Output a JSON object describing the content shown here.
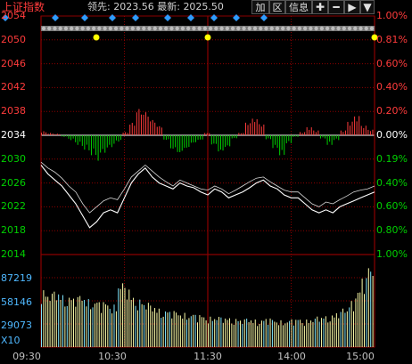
{
  "header": {
    "title": "上证指数",
    "lead_label": "领先:",
    "lead_value": "2023.56",
    "latest_label": "最新:",
    "latest_value": "2025.50"
  },
  "toolbar": {
    "add_label": "加",
    "zone_label": "区",
    "info_label": "信息",
    "plus_icon": "plus-icon",
    "minus_icon": "minus-icon",
    "next_icon": "arrow-right-icon",
    "menu_icon": "dropdown-icon"
  },
  "colors": {
    "up": "#ff3b3b",
    "down": "#00d000",
    "grid": "#8b0000",
    "price_line": "#ffffff",
    "lead_line": "#ffffff",
    "neutral": "#ffffff",
    "volume_bar": "#ffffaa",
    "volume_bar_alt": "#7fe7ff",
    "marker_blue": "#2f9bff",
    "marker_yellow": "#ffff00"
  },
  "price_axis": {
    "left_labels": [
      "2054",
      "2050",
      "2046",
      "2042",
      "2038",
      "2034",
      "2030",
      "2026",
      "2022",
      "2018",
      "2014"
    ],
    "right_labels": [
      "1.00%",
      "0.81%",
      "0.60%",
      "0.40%",
      "0.20%",
      "0.00%",
      "0.19%",
      "0.40%",
      "0.60%",
      "0.80%",
      "1.00%"
    ]
  },
  "volume_axis": {
    "left_labels": [
      "87219",
      "58146",
      "29073",
      "X10"
    ]
  },
  "time_axis": {
    "labels": [
      "09:30",
      "10:30",
      "11:30",
      "14:00",
      "15:00"
    ]
  },
  "chart_data": {
    "type": "line",
    "title": "上证指数",
    "ylim": [
      2014,
      2054
    ],
    "prev_close": 2034,
    "last": 2025.5,
    "lead": 2023.56,
    "x_labels": [
      "09:30",
      "10:30",
      "11:30",
      "14:00",
      "15:00"
    ],
    "series": [
      {
        "name": "最新",
        "values": [
          2029,
          2027.5,
          2026.5,
          2025.5,
          2024,
          2022.5,
          2020.5,
          2018.5,
          2019.5,
          2021,
          2021.5,
          2021,
          2023.5,
          2026,
          2027.5,
          2028.5,
          2027,
          2026,
          2025.5,
          2025,
          2026,
          2025.5,
          2025.2,
          2024.5,
          2024,
          2025,
          2024.5,
          2023.5,
          2024,
          2024.5,
          2025.2,
          2026,
          2026.5,
          2025.5,
          2025,
          2024,
          2023.5,
          2023.5,
          2022.5,
          2021.5,
          2021,
          2021.5,
          2021,
          2022,
          2022.5,
          2023,
          2023.5,
          2024,
          2024.5
        ]
      },
      {
        "name": "领先",
        "values": [
          2029.5,
          2028.5,
          2027.8,
          2026.8,
          2025.5,
          2024.5,
          2022.5,
          2021,
          2022,
          2023,
          2023.5,
          2023.2,
          2025,
          2027,
          2028,
          2029,
          2028,
          2027,
          2026.2,
          2025.5,
          2026.5,
          2026,
          2025.5,
          2025,
          2024.8,
          2025.5,
          2025,
          2024.2,
          2024.8,
          2025.5,
          2026.2,
          2026.8,
          2027,
          2026.2,
          2025.5,
          2024.8,
          2024.5,
          2024.5,
          2023.5,
          2022.5,
          2022,
          2022.8,
          2022.5,
          2023.2,
          2023.8,
          2024.5,
          2024.8,
          2025,
          2025.5
        ]
      }
    ],
    "momentum": [
      0.5,
      0.3,
      0.2,
      -0.2,
      -0.6,
      -1.2,
      -1.8,
      -2.5,
      -3.2,
      -2.2,
      -1.5,
      -0.8,
      0.4,
      1.6,
      3.4,
      3.0,
      2.0,
      1.2,
      -0.6,
      -1.8,
      -2.3,
      -1.7,
      -1.0,
      -0.6,
      0.3,
      -1.2,
      -2.1,
      -1.5,
      -0.4,
      0.3,
      1.6,
      2.1,
      1.4,
      -0.5,
      -1.6,
      -2.5,
      -1.0,
      -0.2,
      0.4,
      1.0,
      0.6,
      -0.4,
      -1.2,
      -0.6,
      0.6,
      1.7,
      2.4,
      1.2,
      0.7
    ],
    "volume": [
      62,
      58,
      60,
      57,
      55,
      54,
      56,
      52,
      50,
      49,
      48,
      46,
      70,
      64,
      55,
      52,
      48,
      45,
      42,
      40,
      39,
      38,
      37,
      36,
      35,
      34,
      33,
      33,
      32,
      32,
      31,
      30,
      31,
      30,
      30,
      31,
      30,
      29,
      29,
      30,
      31,
      30,
      31,
      33,
      34,
      35,
      38,
      42,
      50,
      62,
      75,
      88
    ]
  }
}
